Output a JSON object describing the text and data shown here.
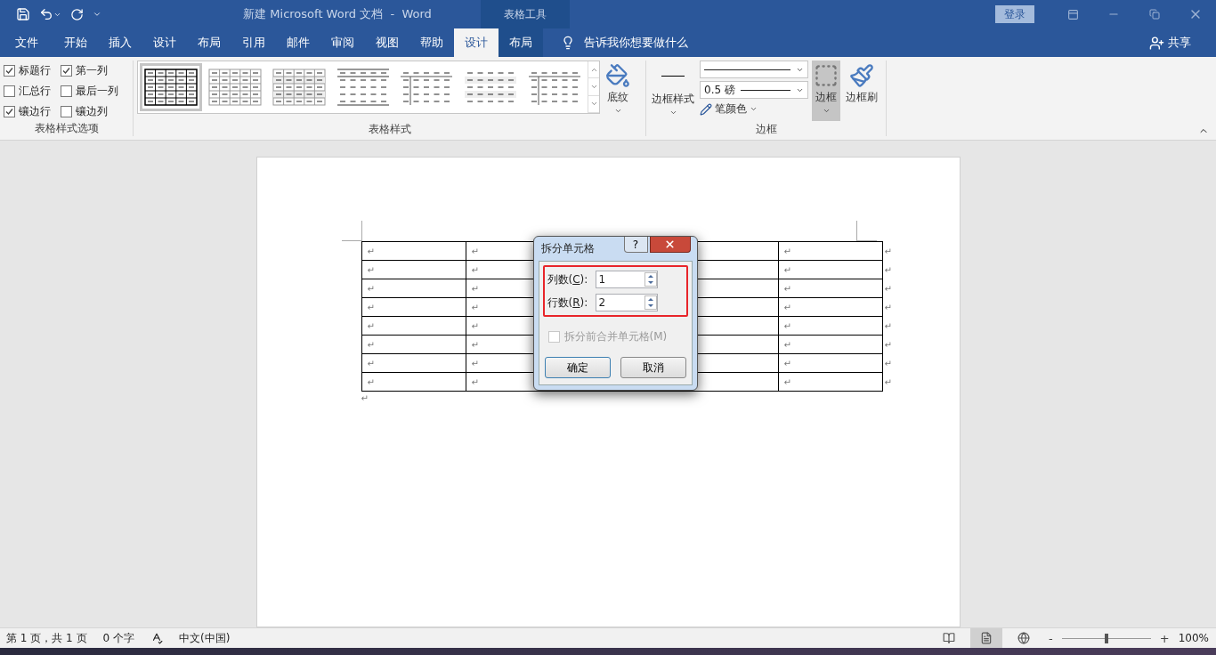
{
  "title_bar": {
    "title": "新建 Microsoft Word 文档  -  Word",
    "context_label": "表格工具",
    "sign_in": "登录"
  },
  "tabs": [
    {
      "label": "文件",
      "selected": false,
      "kind": "normal"
    },
    {
      "label": "开始",
      "selected": false,
      "kind": "normal"
    },
    {
      "label": "插入",
      "selected": false,
      "kind": "normal"
    },
    {
      "label": "设计",
      "selected": false,
      "kind": "normal"
    },
    {
      "label": "布局",
      "selected": false,
      "kind": "normal"
    },
    {
      "label": "引用",
      "selected": false,
      "kind": "normal"
    },
    {
      "label": "邮件",
      "selected": false,
      "kind": "normal"
    },
    {
      "label": "审阅",
      "selected": false,
      "kind": "normal"
    },
    {
      "label": "视图",
      "selected": false,
      "kind": "normal"
    },
    {
      "label": "帮助",
      "selected": false,
      "kind": "normal"
    },
    {
      "label": "设计",
      "selected": true,
      "kind": "contextual"
    },
    {
      "label": "布局",
      "selected": false,
      "kind": "contextual"
    }
  ],
  "tell_me": "告诉我你想要做什么",
  "share": "共享",
  "ribbon": {
    "style_options": {
      "label": "表格样式选项",
      "options": [
        {
          "label": "标题行",
          "checked": true
        },
        {
          "label": "第一列",
          "checked": true
        },
        {
          "label": "汇总行",
          "checked": false
        },
        {
          "label": "最后一列",
          "checked": false
        },
        {
          "label": "镶边行",
          "checked": true
        },
        {
          "label": "镶边列",
          "checked": false
        }
      ]
    },
    "table_styles": {
      "label": "表格样式",
      "shading": "底纹",
      "styles": [
        {
          "kind": "grid",
          "selected": true
        },
        {
          "kind": "light-grid",
          "selected": false
        },
        {
          "kind": "banded-grid",
          "selected": false
        },
        {
          "kind": "lines",
          "selected": false
        },
        {
          "kind": "first-column",
          "selected": false
        },
        {
          "kind": "banded",
          "selected": false
        },
        {
          "kind": "first-column",
          "selected": false
        }
      ]
    },
    "borders": {
      "label": "边框",
      "border_styles": "边框样式",
      "pen_weight": "0.5 磅",
      "pen_color": "笔颜色",
      "borders_button": {
        "label": "边框",
        "pressed": true
      },
      "border_painter": "边框刷"
    }
  },
  "document": {
    "table": {
      "rows": [
        {
          "cells": [
            {
              "mark": "↵"
            },
            {
              "mark": "↵"
            },
            {},
            {},
            {
              "mark": "↵"
            }
          ],
          "end": "↵"
        },
        {
          "cells": [
            {
              "mark": "↵"
            },
            {
              "mark": "↵"
            },
            {},
            {},
            {
              "mark": "↵"
            }
          ],
          "end": "↵"
        },
        {
          "cells": [
            {
              "mark": "↵"
            },
            {
              "mark": "↵"
            },
            {},
            {},
            {
              "mark": "↵"
            }
          ],
          "end": "↵"
        },
        {
          "cells": [
            {
              "mark": "↵"
            },
            {
              "mark": "↵"
            },
            {},
            {},
            {
              "mark": "↵"
            }
          ],
          "end": "↵"
        },
        {
          "cells": [
            {
              "mark": "↵"
            },
            {
              "mark": "↵"
            },
            {},
            {},
            {
              "mark": "↵"
            }
          ],
          "end": "↵"
        },
        {
          "cells": [
            {
              "mark": "↵"
            },
            {
              "mark": "↵"
            },
            {},
            {},
            {
              "mark": "↵"
            }
          ],
          "end": "↵"
        },
        {
          "cells": [
            {
              "mark": "↵"
            },
            {
              "mark": "↵"
            },
            {},
            {},
            {
              "mark": "↵"
            }
          ],
          "end": "↵"
        },
        {
          "cells": [
            {
              "mark": "↵"
            },
            {
              "mark": "↵"
            },
            {},
            {},
            {
              "mark": "↵"
            }
          ],
          "end": "↵"
        }
      ]
    },
    "paragraph_mark": "↵"
  },
  "dialog": {
    "title": "拆分单元格",
    "help": "?",
    "highlight_fields": true,
    "fields": [
      {
        "label_before": "列数(",
        "access_key": "C",
        "label_after": "):",
        "value": "1"
      },
      {
        "label_before": "行数(",
        "access_key": "R",
        "label_after": "):",
        "value": "2"
      }
    ],
    "merge_checkbox": {
      "label": "拆分前合并单元格(M)",
      "checked": false,
      "disabled": true
    },
    "buttons": [
      {
        "label": "确定",
        "default": true
      },
      {
        "label": "取消",
        "default": false
      }
    ]
  },
  "status_bar": {
    "page": "第 1 页，共 1 页",
    "words": "0 个字",
    "language": "中文(中国)",
    "views": [
      {
        "kind": "read",
        "selected": false
      },
      {
        "kind": "print",
        "selected": true
      },
      {
        "kind": "web",
        "selected": false
      }
    ],
    "zoom_minus": "-",
    "zoom_plus": "+",
    "zoom": {
      "level": 0.5
    },
    "zoom_text": "100%"
  }
}
